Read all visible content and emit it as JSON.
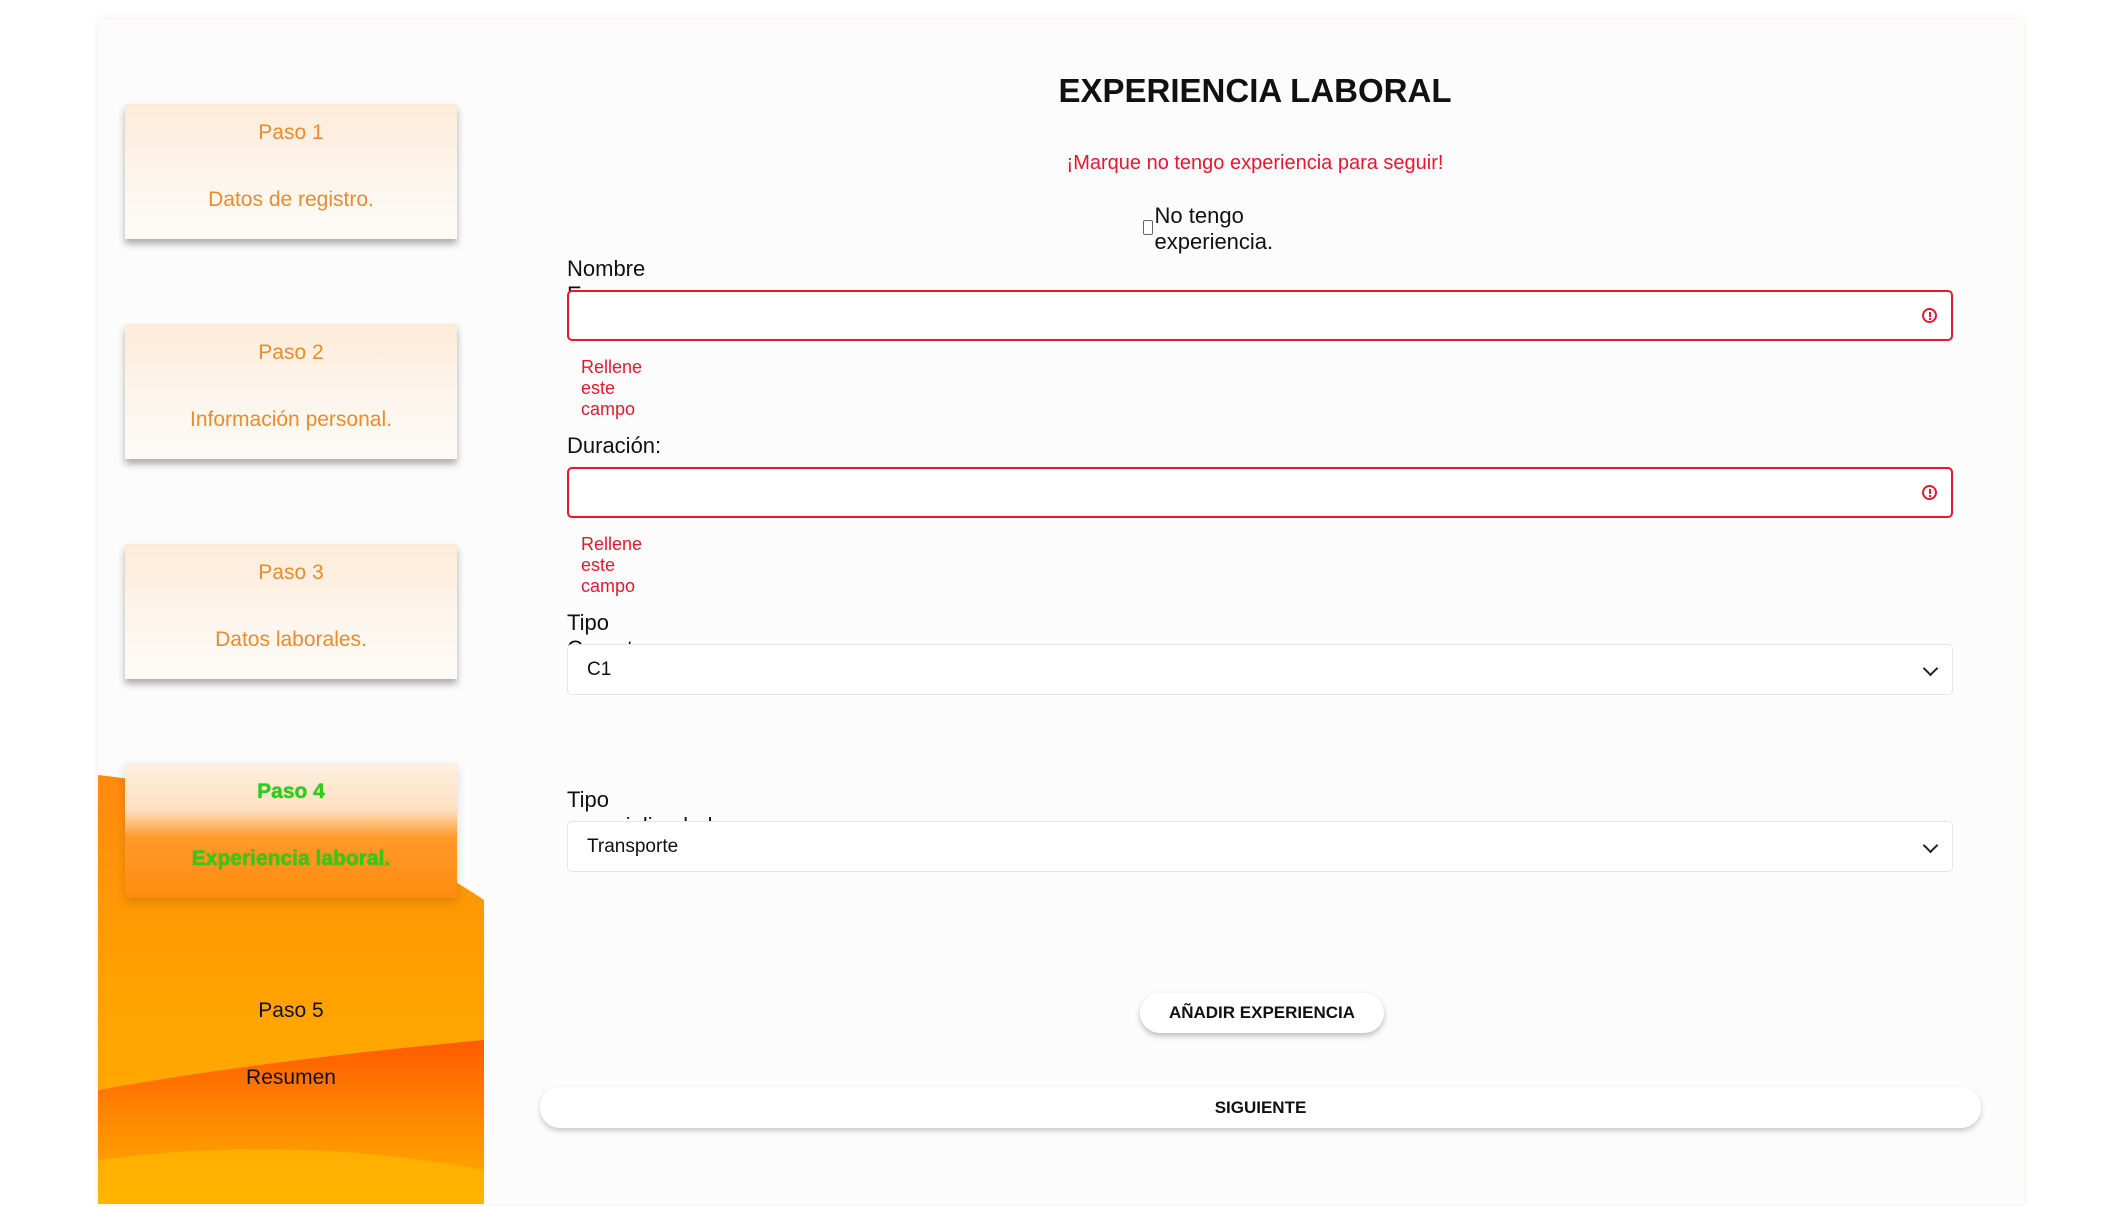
{
  "sidebar": {
    "steps": [
      {
        "num": "Paso 1",
        "desc": "Datos de registro."
      },
      {
        "num": "Paso 2",
        "desc": "Información personal."
      },
      {
        "num": "Paso 3",
        "desc": "Datos laborales."
      },
      {
        "num": "Paso 4",
        "desc": "Experiencia laboral."
      },
      {
        "num": "Paso 5",
        "desc": "Resumen"
      }
    ],
    "active_step": 4
  },
  "form": {
    "title": "EXPERIENCIA LABORAL",
    "warning": "¡Marque no tengo experiencia para seguir!",
    "no_experience_label": "No tengo experiencia.",
    "no_experience_checked": false,
    "company_label": "Nombre Empresa:",
    "company_value": "",
    "company_error": "Rellene este campo",
    "duration_label": "Duración:",
    "duration_value": "",
    "duration_error": "Rellene este campo",
    "license_label": "Tipo Carnet:",
    "license_value": "C1",
    "specialty_label": "Tipo especializadad:",
    "specialty_value": "Transporte",
    "add_button": "AÑADIR EXPERIENCIA",
    "next_button": "SIGUIENTE"
  },
  "colors": {
    "accent_orange": "#f08a2a",
    "error_red": "#e8182a",
    "active_green": "#2ecc1a"
  }
}
